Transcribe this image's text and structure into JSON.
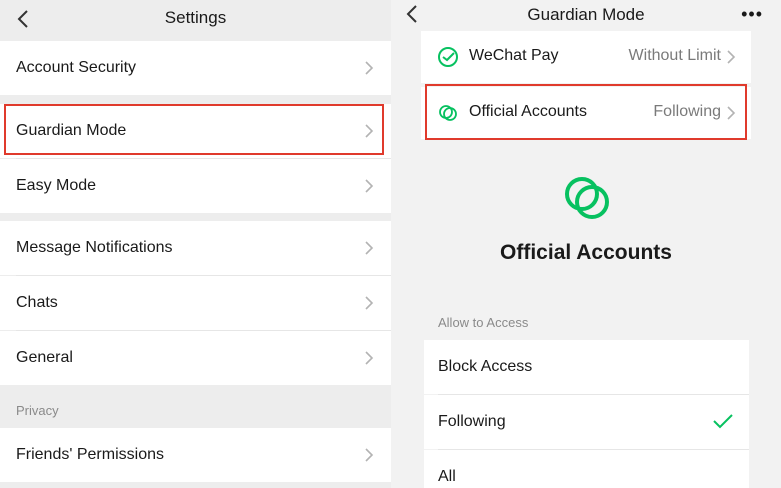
{
  "settings": {
    "title": "Settings",
    "items": [
      {
        "label": "Account Security"
      },
      {
        "label": "Guardian Mode"
      },
      {
        "label": "Easy Mode"
      },
      {
        "label": "Message Notifications"
      },
      {
        "label": "Chats"
      },
      {
        "label": "General"
      }
    ],
    "privacy": {
      "section_label": "Privacy",
      "items": [
        {
          "label": "Friends' Permissions"
        }
      ]
    }
  },
  "guardian": {
    "title": "Guardian Mode",
    "more_label": "•••",
    "cards": [
      {
        "icon": "wechat-pay-icon",
        "label": "WeChat Pay",
        "value": "Without Limit"
      },
      {
        "icon": "official-accounts-icon",
        "label": "Official Accounts",
        "value": "Following"
      }
    ],
    "detail": {
      "icon": "official-accounts-logo",
      "title": "Official Accounts",
      "allow_label": "Allow to Access",
      "options": [
        {
          "label": "Block Access",
          "selected": false
        },
        {
          "label": "Following",
          "selected": true
        },
        {
          "label": "All",
          "selected": false
        }
      ]
    }
  },
  "colors": {
    "accent_green": "#07c160",
    "highlight_red": "#e03a2c"
  }
}
